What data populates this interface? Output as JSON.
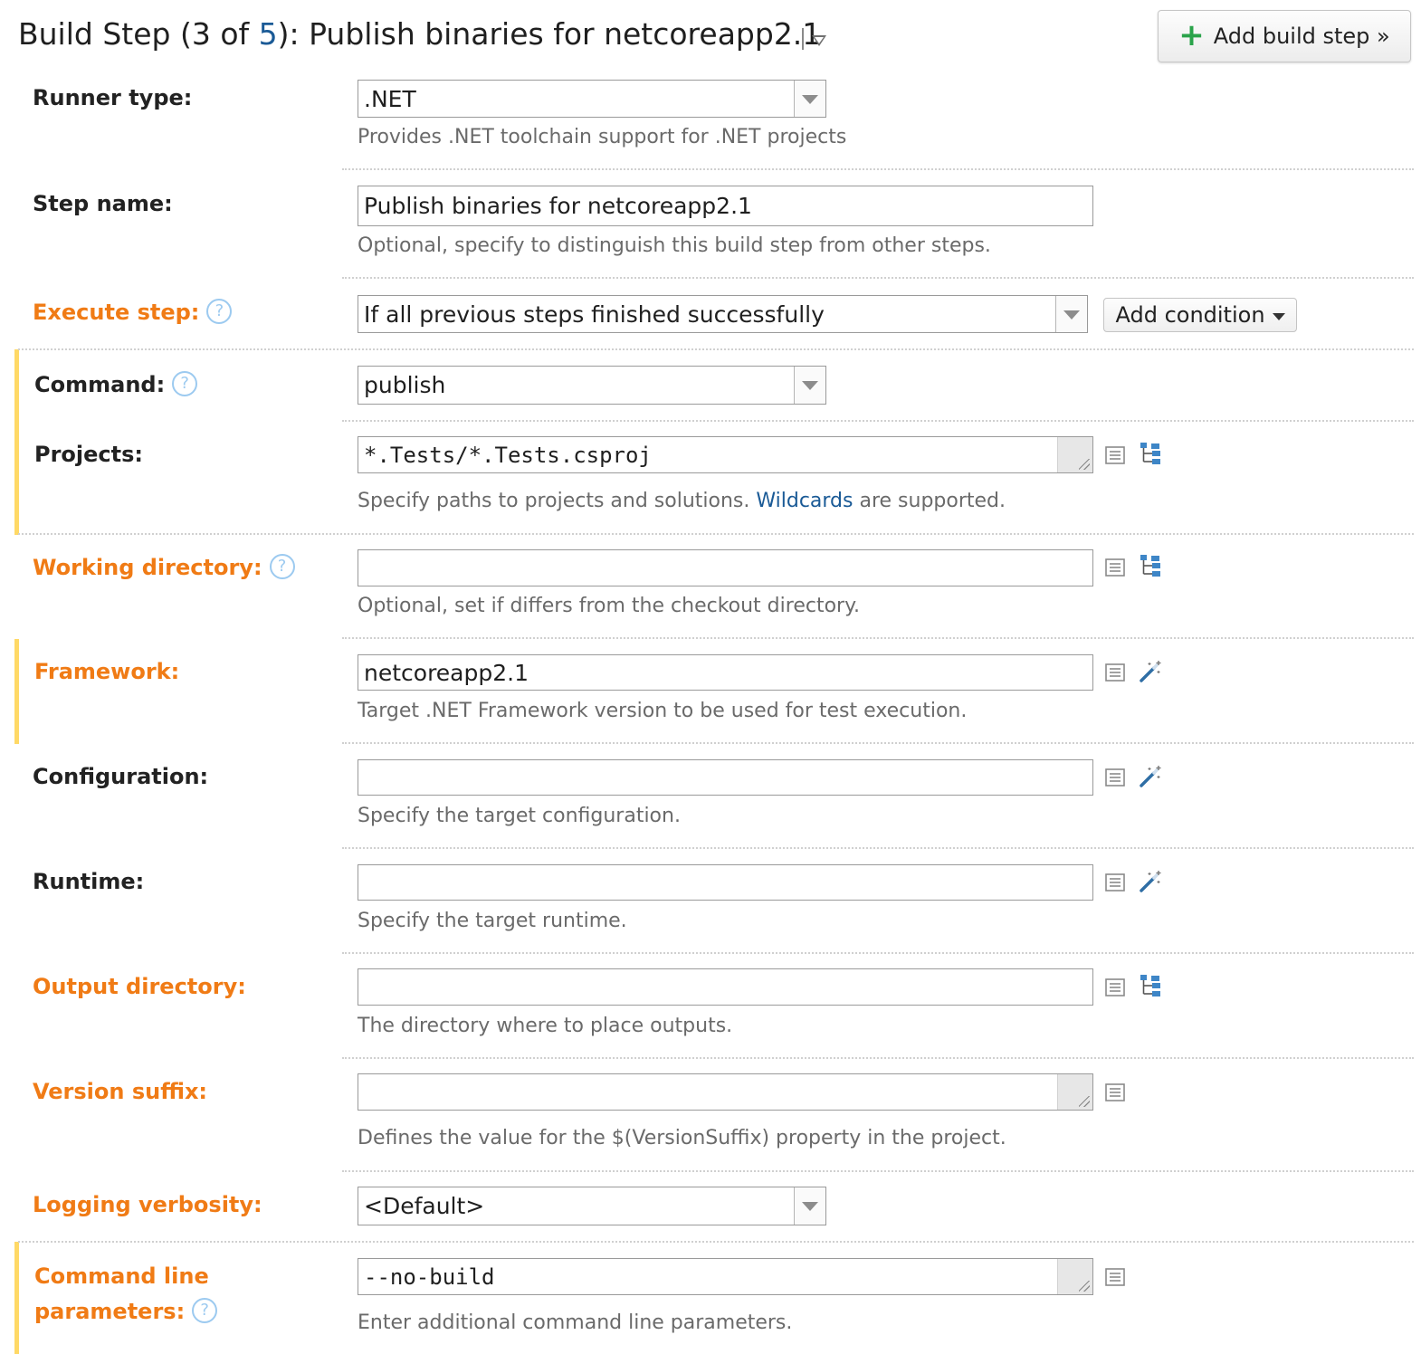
{
  "header": {
    "title_prefix": "Build Step (3 of ",
    "title_step_total": "5",
    "title_suffix": "): Publish binaries for netcoreapp2.1",
    "add_build_step_label": "Add build step »"
  },
  "icons": {
    "plus": "plus-icon",
    "help": "help-icon",
    "text_editor": "list-icon",
    "tree_picker": "tree-icon",
    "magic_wand": "wand-icon",
    "dropdown": "chevron-down-icon"
  },
  "colors": {
    "optional_label": "#f07b15",
    "required_label": "#222222",
    "link": "#1a5a96",
    "highlight_bar": "#ffd966",
    "help_icon": "#9ccaf0",
    "add_icon": "#2aa34a"
  },
  "help_glyph": "?",
  "fields": {
    "runner_type": {
      "label": "Runner type:",
      "value": ".NET",
      "hint": "Provides .NET toolchain support for .NET projects"
    },
    "step_name": {
      "label": "Step name:",
      "value": "Publish binaries for netcoreapp2.1",
      "hint": "Optional, specify to distinguish this build step from other steps."
    },
    "execute_step": {
      "label": "Execute step:",
      "value": "If all previous steps finished successfully",
      "add_condition_label": "Add condition"
    },
    "command": {
      "label": "Command:",
      "value": "publish"
    },
    "projects": {
      "label": "Projects:",
      "value": "*.Tests/*.Tests.csproj",
      "hint_before": "Specify paths to projects and solutions. ",
      "hint_link": "Wildcards",
      "hint_after": " are supported."
    },
    "working_directory": {
      "label": "Working directory:",
      "value": "",
      "hint": "Optional, set if differs from the checkout directory."
    },
    "framework": {
      "label": "Framework:",
      "value": "netcoreapp2.1",
      "hint": "Target .NET Framework version to be used for test execution."
    },
    "configuration": {
      "label": "Configuration:",
      "value": "",
      "hint": "Specify the target configuration."
    },
    "runtime": {
      "label": "Runtime:",
      "value": "",
      "hint": "Specify the target runtime."
    },
    "output_directory": {
      "label": "Output directory:",
      "value": "",
      "hint": "The directory where to place outputs."
    },
    "version_suffix": {
      "label": "Version suffix:",
      "value": "",
      "hint": "Defines the value for the $(VersionSuffix) property in the project."
    },
    "logging_verbosity": {
      "label": "Logging verbosity:",
      "value": "<Default>"
    },
    "command_line_parameters": {
      "label_line1": "Command line",
      "label_line2": "parameters:",
      "value": "--no-build",
      "hint": "Enter additional command line parameters."
    }
  }
}
